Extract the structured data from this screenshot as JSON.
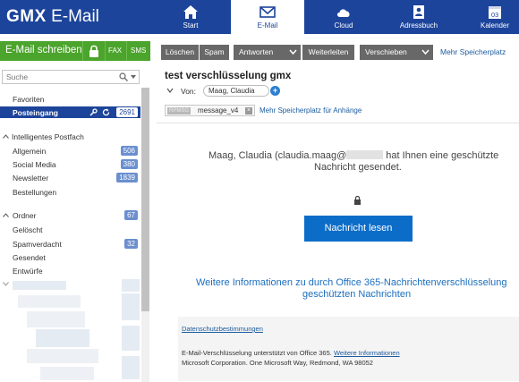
{
  "app": {
    "logo_brand": "GMX",
    "logo_product": "E-Mail"
  },
  "nav": [
    {
      "id": "start",
      "label": "Start",
      "icon": "home-icon"
    },
    {
      "id": "email",
      "label": "E-Mail",
      "icon": "envelope-icon",
      "active": true
    },
    {
      "id": "cloud",
      "label": "Cloud",
      "icon": "cloud-icon"
    },
    {
      "id": "addressbook",
      "label": "Adressbuch",
      "icon": "contact-card-icon"
    },
    {
      "id": "calendar",
      "label": "Kalender",
      "icon": "calendar-icon",
      "day": "03"
    }
  ],
  "sidebar": {
    "compose_label": "E-Mail schreiben",
    "fax_label": "FAX",
    "sms_label": "SMS",
    "search_placeholder": "Suche",
    "favorites_label": "Favoriten",
    "inbox": {
      "label": "Posteingang",
      "count": "2691"
    },
    "smart_section": "Intelligentes Postfach",
    "smart_items": [
      {
        "label": "Allgemein",
        "count": "506"
      },
      {
        "label": "Social Media",
        "count": "380"
      },
      {
        "label": "Newsletter",
        "count": "1839"
      },
      {
        "label": "Bestellungen",
        "count": ""
      }
    ],
    "folders_section": {
      "label": "Ordner",
      "count": "67"
    },
    "folder_items": [
      {
        "label": "Gelöscht",
        "count": ""
      },
      {
        "label": "Spamverdacht",
        "count": "32"
      },
      {
        "label": "Gesendet",
        "count": ""
      },
      {
        "label": "Entwürfe",
        "count": ""
      }
    ]
  },
  "toolbar": {
    "delete": "Löschen",
    "spam": "Spam",
    "reply": "Antworten",
    "forward": "Weiterleiten",
    "move": "Verschieben",
    "more_storage": "Mehr Speicherplatz"
  },
  "message": {
    "subject": "test verschlüsselung gmx",
    "from_label": "Von:",
    "sender": "Maag, Claudia",
    "attachment": {
      "type": "RPMSG",
      "name": "message_v4"
    },
    "attachment_link": "Mehr Speicherplatz für Anhänge",
    "body_line1_a": "Maag, Claudia (claudia.maag@",
    "body_line1_b": " hat Ihnen eine geschützte",
    "body_line2": "Nachricht gesendet.",
    "read_button": "Nachricht lesen",
    "info_line1": "Weitere Informationen zu durch Office 365-Nachrichtenverschlüsselung",
    "info_line2": "geschützten Nachrichten",
    "privacy_link": "Datenschutzbestimmungen",
    "footer_text": "E-Mail-Verschlüsselung unterstützt von Office 365.",
    "footer_link": "Weitere Informationen",
    "footer_address": "Microsoft Corporation. One Microsoft Way, Redmond, WA 98052"
  },
  "colors": {
    "brand": "#1c449b",
    "compose": "#4ba42b",
    "toolbar": "#686868",
    "primary_button": "#0c6dc9",
    "link": "#1c6fbe"
  }
}
